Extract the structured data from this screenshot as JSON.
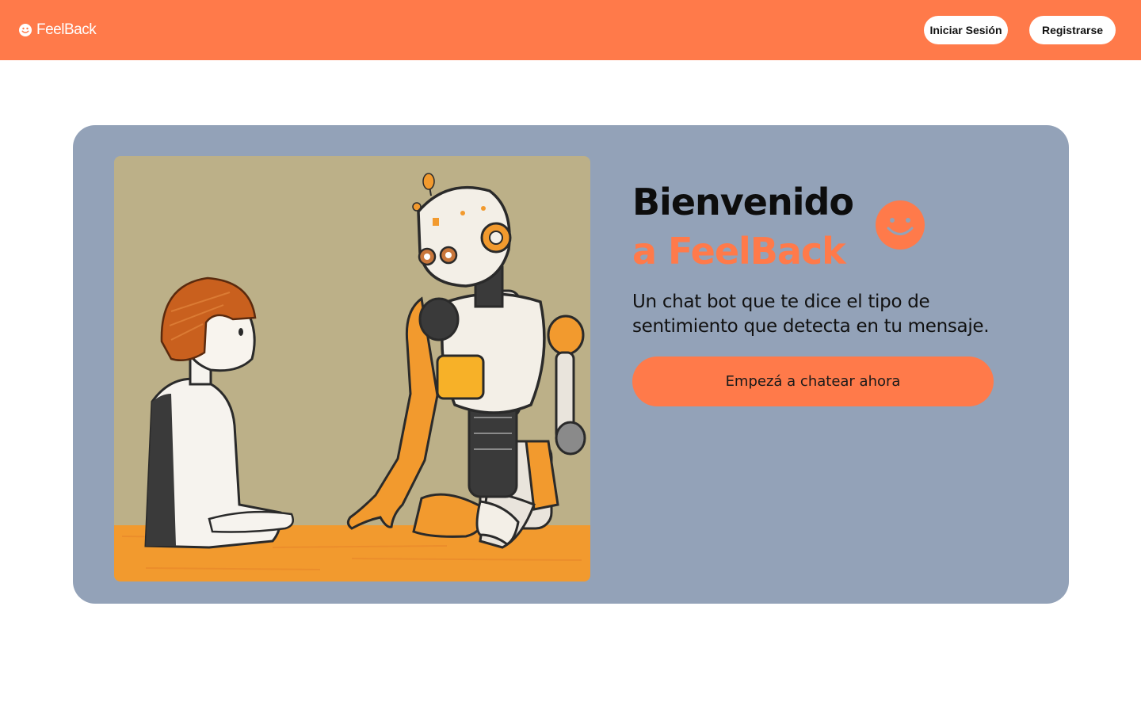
{
  "navbar": {
    "brand_name": "FeelBack",
    "brand_icon": "smiley-icon",
    "login_label": "Iniciar Sesión",
    "register_label": "Registrarse",
    "color": "#ff7a4a"
  },
  "hero": {
    "title_line_1": "Bienvenido",
    "title_line_2": "a FeelBack",
    "subtitle": "Un chat bot que te dice el tipo de sentimiento que detecta en tu mensaje.",
    "cta_label": "Empezá a chatear ahora",
    "background_color": "#93a2b8",
    "accent_color": "#ff7a4a",
    "illustration": "boy-and-robot-illustration",
    "decoration_icon": "smiley-icon"
  }
}
